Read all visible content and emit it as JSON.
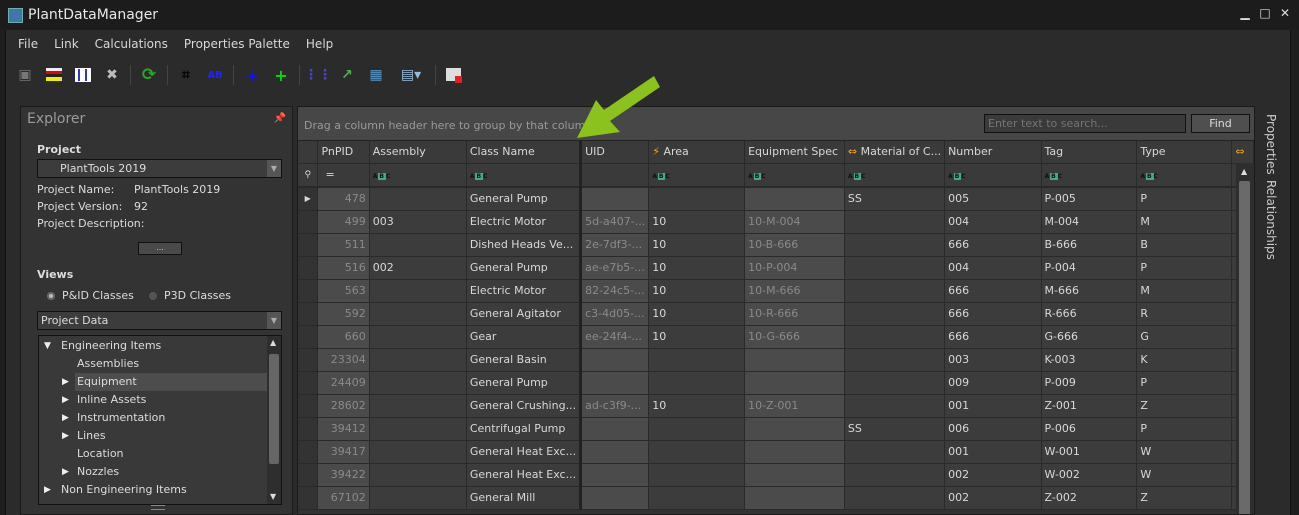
{
  "window": {
    "title": "PlantDataManager"
  },
  "menu": [
    "File",
    "Link",
    "Calculations",
    "Properties Palette",
    "Help"
  ],
  "toolbar": [
    "save-icon",
    "color-rows-icon",
    "columns-icon",
    "delete-icon",
    "refresh-icon",
    "find-icon",
    "find-replace-icon",
    "add-icon",
    "add-symbol-icon",
    "select-columns-icon",
    "export-icon",
    "import-icon",
    "report-icon",
    "close-report-icon"
  ],
  "explorer": {
    "title": "Explorer",
    "project_label": "Project",
    "project_selected": "PlantTools 2019",
    "project_name_label": "Project Name:",
    "project_name": "PlantTools 2019",
    "project_version_label": "Project Version:",
    "project_version": "92",
    "project_description_label": "Project Description:",
    "more_button": "...",
    "views_label": "Views",
    "radio_pid": "P&ID Classes",
    "radio_p3d": "P3D Classes",
    "radio_selected": "P&ID Classes",
    "data_selected": "Project Data",
    "tree": [
      {
        "label": "Engineering Items",
        "level": 0,
        "expander": "expanded"
      },
      {
        "label": "Assemblies",
        "level": 1,
        "expander": "none"
      },
      {
        "label": "Equipment",
        "level": 1,
        "expander": "collapsed",
        "selected": true
      },
      {
        "label": "Inline Assets",
        "level": 1,
        "expander": "collapsed"
      },
      {
        "label": "Instrumentation",
        "level": 1,
        "expander": "collapsed"
      },
      {
        "label": "Lines",
        "level": 1,
        "expander": "collapsed"
      },
      {
        "label": "Location",
        "level": 1,
        "expander": "none"
      },
      {
        "label": "Nozzles",
        "level": 1,
        "expander": "collapsed"
      },
      {
        "label": "Non Engineering Items",
        "level": 0,
        "expander": "collapsed"
      }
    ]
  },
  "grid": {
    "group_hint": "Drag a column header here to group by that column",
    "search_placeholder": "Enter text to search...",
    "find_button": "Find",
    "columns": [
      "PnPID",
      "Assembly",
      "Class Name",
      "UID",
      "Area",
      "Equipment Spec",
      "Material of C...",
      "Number",
      "Tag",
      "Type"
    ],
    "filter_pnpid": "=",
    "rows": [
      [
        "478",
        "",
        "General Pump",
        "",
        "",
        "",
        "SS",
        "005",
        "P-005",
        "P"
      ],
      [
        "499",
        "003",
        "Electric Motor",
        "5d-a407-...",
        "10",
        "10-M-004",
        "",
        "004",
        "M-004",
        "M"
      ],
      [
        "511",
        "",
        "Dished Heads Ve...",
        "2e-7df3-...",
        "10",
        "10-B-666",
        "",
        "666",
        "B-666",
        "B"
      ],
      [
        "516",
        "002",
        "General Pump",
        "ae-e7b5-...",
        "10",
        "10-P-004",
        "",
        "004",
        "P-004",
        "P"
      ],
      [
        "563",
        "",
        "Electric Motor",
        "82-24c5-...",
        "10",
        "10-M-666",
        "",
        "666",
        "M-666",
        "M"
      ],
      [
        "592",
        "",
        "General Agitator",
        "c3-4d05-...",
        "10",
        "10-R-666",
        "",
        "666",
        "R-666",
        "R"
      ],
      [
        "660",
        "",
        "Gear",
        "ee-24f4-...",
        "10",
        "10-G-666",
        "",
        "666",
        "G-666",
        "G"
      ],
      [
        "23304",
        "",
        "General Basin",
        "",
        "",
        "",
        "",
        "003",
        "K-003",
        "K"
      ],
      [
        "24409",
        "",
        "General Pump",
        "",
        "",
        "",
        "",
        "009",
        "P-009",
        "P"
      ],
      [
        "28602",
        "",
        "General Crushing...",
        "ad-c3f9-...",
        "10",
        "10-Z-001",
        "",
        "001",
        "Z-001",
        "Z"
      ],
      [
        "39412",
        "",
        "Centrifugal Pump",
        "",
        "",
        "",
        "SS",
        "006",
        "P-006",
        "P"
      ],
      [
        "39417",
        "",
        "General Heat Exc...",
        "",
        "",
        "",
        "",
        "001",
        "W-001",
        "W"
      ],
      [
        "39422",
        "",
        "General Heat Exc...",
        "",
        "",
        "",
        "",
        "002",
        "W-002",
        "W"
      ],
      [
        "67102",
        "",
        "General Mill",
        "",
        "",
        "",
        "",
        "002",
        "Z-002",
        "Z"
      ]
    ]
  },
  "side_tabs": [
    "Properties",
    "Relationships"
  ],
  "colors": {
    "annotation_arrow": "#8cc21e",
    "readonly_cell": "#4b4b4b",
    "filter_badge": "#3fa989"
  }
}
